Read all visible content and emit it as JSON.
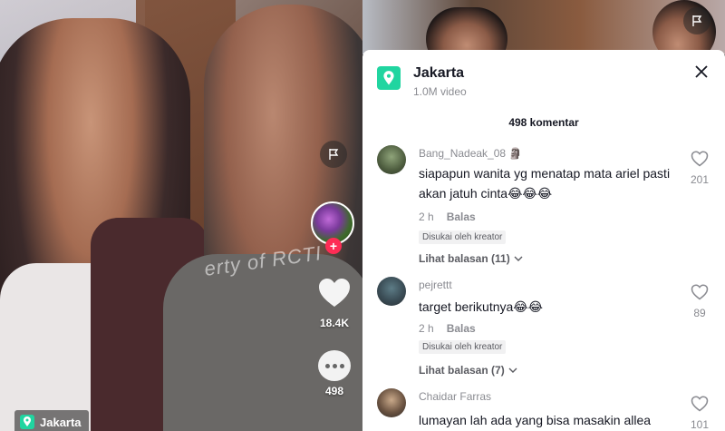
{
  "video": {
    "watermark": "erty of RCTI",
    "like_count": "18.4K",
    "comment_count": "498",
    "location_tag": "Jakarta"
  },
  "sheet": {
    "title": "Jakarta",
    "subtitle": "1.0M video",
    "comment_total": "498 komentar",
    "comments": [
      {
        "user": "Bang_Nadeak_08 🗿",
        "text": "siapapun wanita yg menatap mata ariel pasti akan jatuh cinta😂😂😂",
        "time": "2 h",
        "reply": "Balas",
        "creator_badge": "Disukai oleh kreator",
        "replies": "Lihat balasan (11)",
        "likes": "201"
      },
      {
        "user": "pejrettt",
        "text": "target berikutnya😂😂",
        "time": "2 h",
        "reply": "Balas",
        "creator_badge": "Disukai oleh kreator",
        "replies": "Lihat balasan (7)",
        "likes": "89"
      },
      {
        "user": "Chaidar Farras",
        "text": "lumayan lah ada yang bisa masakin allea",
        "likes": "101"
      }
    ]
  },
  "colors": {
    "accent_location": "#20d5a0",
    "follow_red": "#fe2c55",
    "muted_text": "#8a8b91"
  }
}
